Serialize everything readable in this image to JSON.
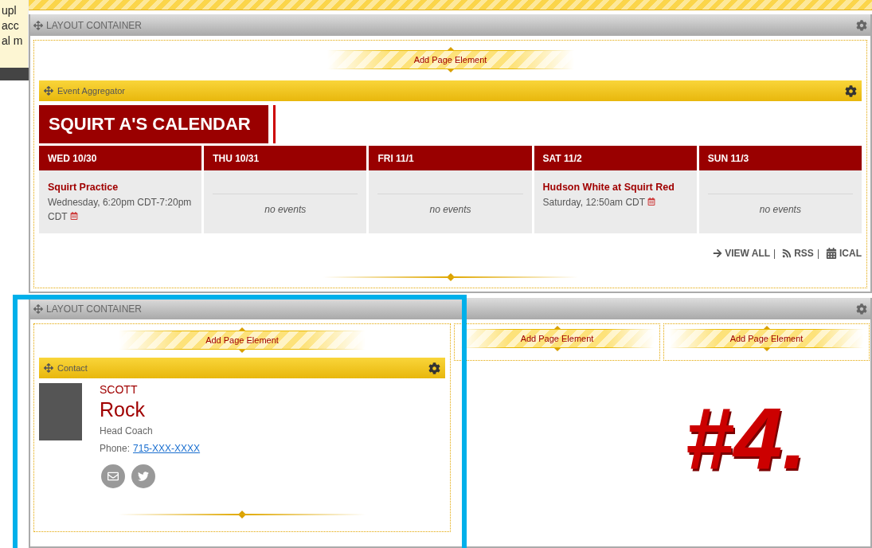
{
  "notice": {
    "lines": [
      "upl",
      "acc",
      "al m"
    ]
  },
  "top_container": {
    "title": "LAYOUT CONTAINER",
    "add_element": "Add Page Element",
    "element": {
      "title": "Event Aggregator",
      "calendar_title": "SQUIRT A'S CALENDAR",
      "days": [
        {
          "heading": "WED 10/30",
          "events": [
            {
              "name": "Squirt Practice",
              "time": "Wednesday, 6:20pm CDT-7:20pm CDT"
            }
          ]
        },
        {
          "heading": "THU 10/31",
          "empty_text": "no events"
        },
        {
          "heading": "FRI 11/1",
          "empty_text": "no events"
        },
        {
          "heading": "SAT 11/2",
          "events": [
            {
              "name": "Hudson White at Squirt Red",
              "time": "Saturday, 12:50am CDT"
            }
          ]
        },
        {
          "heading": "SUN 11/3",
          "empty_text": "no events"
        }
      ],
      "links": [
        {
          "kind": "arrow",
          "label": "VIEW ALL",
          "separator": "|"
        },
        {
          "kind": "rss",
          "label": "RSS",
          "separator": "|"
        },
        {
          "kind": "calendar",
          "label": "ICAL"
        }
      ]
    }
  },
  "bottom_container": {
    "title": "LAYOUT CONTAINER",
    "columns": [
      {
        "add_element": "Add Page Element",
        "element": {
          "title": "Contact",
          "first_name": "SCOTT",
          "last_name": "Rock",
          "role": "Head Coach",
          "phone_label": "Phone:",
          "phone": "715-XXX-XXXX"
        }
      },
      {
        "add_element": "Add Page Element"
      },
      {
        "add_element": "Add Page Element"
      }
    ]
  },
  "annotation": {
    "text": "#4."
  }
}
